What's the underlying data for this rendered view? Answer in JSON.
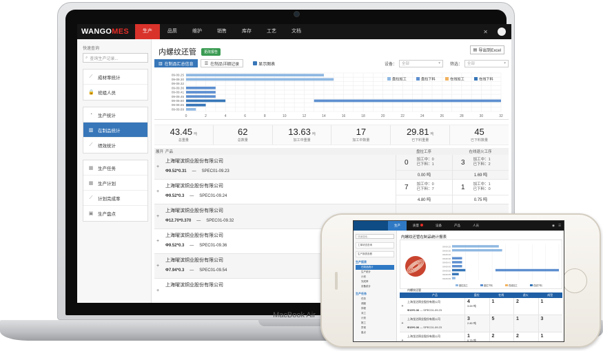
{
  "laptop": {
    "brand": "MacBook Air",
    "app": {
      "logo_a": "WANGO",
      "logo_b": "MES",
      "nav": [
        "生产",
        "品质",
        "维护",
        "销售",
        "库存",
        "工艺",
        "文档"
      ],
      "nav_active": 0,
      "sidebar": {
        "quick_label": "快速查询",
        "search_placeholder": "查询生产记录...",
        "groups": [
          [
            {
              "label": "成材率统计",
              "icon": "line-chart-icon"
            },
            {
              "label": "班组人员",
              "icon": "lock-icon"
            }
          ],
          [
            {
              "label": "生产统计",
              "icon": "pie-chart-icon"
            },
            {
              "label": "在制品统计",
              "icon": "bar-chart-icon",
              "active": true
            },
            {
              "label": "绩效统计",
              "icon": "line-chart-icon"
            }
          ],
          [
            {
              "label": "生产任务",
              "icon": "calendar-icon"
            },
            {
              "label": "生产计划",
              "icon": "calendar-icon"
            },
            {
              "label": "计划完成率",
              "icon": "line-chart-icon"
            },
            {
              "label": "生产盘点",
              "icon": "calculator-icon"
            }
          ]
        ]
      },
      "page_title": "内螺纹还管",
      "badge": "更改报告",
      "export_label": "导出到Excel",
      "tabs": [
        "在制品汇总信息",
        "在制品详细记录"
      ],
      "tab_active": 0,
      "show_chart_label": "显示图表",
      "device_label": "设备：",
      "device_value": "全部",
      "filter_label": "筛选：",
      "filter_value": "全部",
      "stats": [
        {
          "value": "43.45",
          "unit": "吨",
          "label": "总重量"
        },
        {
          "value": "62",
          "unit": "",
          "label": "总数量"
        },
        {
          "value": "13.63",
          "unit": "吨",
          "label": "加工中重量"
        },
        {
          "value": "17",
          "unit": "",
          "label": "加工中数量"
        },
        {
          "value": "29.81",
          "unit": "吨",
          "label": "已下料重量"
        },
        {
          "value": "45",
          "unit": "",
          "label": "已下料数量"
        }
      ],
      "table_head": {
        "expand": "展开",
        "product": "产品",
        "seg1": "盘拉工序",
        "seg2": "在线退火工序"
      },
      "rows": [
        {
          "name": "上海曜滨铜业股份有限公司",
          "spec": "Φ9.52*0.31",
          "code": "SPEC01-09.23",
          "s1_big": "0",
          "s1_a": "加工中：0",
          "s1_b": "已下料：1",
          "s1_w": "0.00 吨",
          "s2_big": "3",
          "s2_a": "加工中：1",
          "s2_b": "已下料：2",
          "s2_w": "1.69 吨"
        },
        {
          "name": "上海曜滨铜业股份有限公司",
          "spec": "Φ9.52*0.3",
          "code": "SPEC01-09.24",
          "s1_big": "7",
          "s1_a": "加工中：0",
          "s1_b": "已下料：7",
          "s1_w": "4.80 吨",
          "s2_big": "1",
          "s2_a": "加工中：1",
          "s2_b": "已下料：0",
          "s2_w": "0.75 吨"
        },
        {
          "name": "上海曜滨铜业股份有限公司",
          "spec": "Φ12.70*0.370",
          "code": "SPEC01-09.32",
          "s1_big": "",
          "s1_a": "",
          "s1_b": "",
          "s1_w": "",
          "s2_big": "",
          "s2_a": "",
          "s2_b": "",
          "s2_w": ""
        },
        {
          "name": "上海曜滨铜业股份有限公司",
          "spec": "Φ9.52*0.3",
          "code": "SPEC01-09.36",
          "s1_big": "",
          "s1_a": "",
          "s1_b": "",
          "s1_w": "",
          "s2_big": "",
          "s2_a": "",
          "s2_b": "",
          "s2_w": ""
        },
        {
          "name": "上海曜滨铜业股份有限公司",
          "spec": "Φ7.94*0.3",
          "code": "SPEC01-09.54",
          "s1_big": "",
          "s1_a": "",
          "s1_b": "",
          "s1_w": "",
          "s2_big": "",
          "s2_a": "",
          "s2_b": "",
          "s2_w": ""
        },
        {
          "name": "上海曜滨铜业股份有限公司",
          "spec": "",
          "code": "",
          "s1_big": "",
          "s1_a": "",
          "s1_b": "",
          "s1_w": "",
          "s2_big": "",
          "s2_a": "",
          "s2_b": "",
          "s2_w": ""
        }
      ]
    }
  },
  "chart_data": {
    "type": "bar",
    "orientation": "horizontal",
    "categories": [
      "09-09.25",
      "09-09.30",
      "09-09.32",
      "09-09.36",
      "09-09.41",
      "09-09.45",
      "09-09.60",
      "09-09.65",
      "09-09.69"
    ],
    "series": [
      {
        "name": "盘拉加工",
        "color": "#8fb8e2",
        "values": [
          14,
          15,
          0,
          0,
          0,
          0,
          0,
          0,
          1
        ]
      },
      {
        "name": "盘拉下料",
        "color": "#5d8fd0",
        "values": [
          0,
          0,
          0,
          3,
          3,
          3,
          0,
          0,
          0
        ]
      },
      {
        "name": "在线加工",
        "color": "#f2b25f",
        "values": [
          0,
          0,
          0,
          0,
          0,
          0,
          0,
          0,
          0
        ]
      },
      {
        "name": "在线下料",
        "color": "#3776b8",
        "values": [
          0,
          0,
          0,
          0,
          0,
          0,
          4,
          2,
          0
        ]
      }
    ],
    "long_bar": {
      "category": "09-09.60",
      "start": 13,
      "end": 32
    },
    "xlim": [
      0,
      32
    ],
    "xticks": [
      0,
      2,
      4,
      6,
      8,
      10,
      12,
      14,
      16,
      18,
      20,
      22,
      24,
      26,
      28,
      30,
      32
    ],
    "legend": "top-right",
    "grid": true
  },
  "phone": {
    "nav": [
      "生产",
      "质量",
      "设备",
      "产品",
      "人员"
    ],
    "nav_active": 0,
    "search": "快速搜索...",
    "side_items_top": [
      "工单状态查询",
      "生产报表查看"
    ],
    "group1_title": "生产报表",
    "group1_items": [
      "在制品统计",
      "生产统计",
      "计划",
      "完成率",
      "设备统计"
    ],
    "group2_title": "生产任务",
    "group2_items": [
      "任务",
      "调度",
      "排程",
      "派工",
      "计划",
      "报工",
      "异常",
      "盘点"
    ],
    "page_title": "内螺纹还管在制品统计报表",
    "caption": "内螺纹还管",
    "head": [
      "产品",
      "盘拉",
      "在线",
      "退火",
      "成型"
    ],
    "rows": [
      {
        "name": "上海龙沽铜业股份有限公司",
        "spec": "Φ15*0.36",
        "code": "SPEC01-09.23",
        "v": [
          "4",
          "1",
          "2",
          "1"
        ],
        "w": "3.69 吨"
      },
      {
        "name": "上海龙沽铜业股份有限公司",
        "spec": "Φ15*0.36",
        "code": "SPEC01-09.23",
        "v": [
          "3",
          "5",
          "1",
          "3"
        ],
        "w": "2.80 吨"
      },
      {
        "name": "上海龙沽铜业股份有限公司",
        "spec": "Φ15*0.36",
        "code": "SPEC01-09.23",
        "v": [
          "1",
          "2",
          "2",
          "1"
        ],
        "w": "0.75 吨"
      }
    ]
  }
}
